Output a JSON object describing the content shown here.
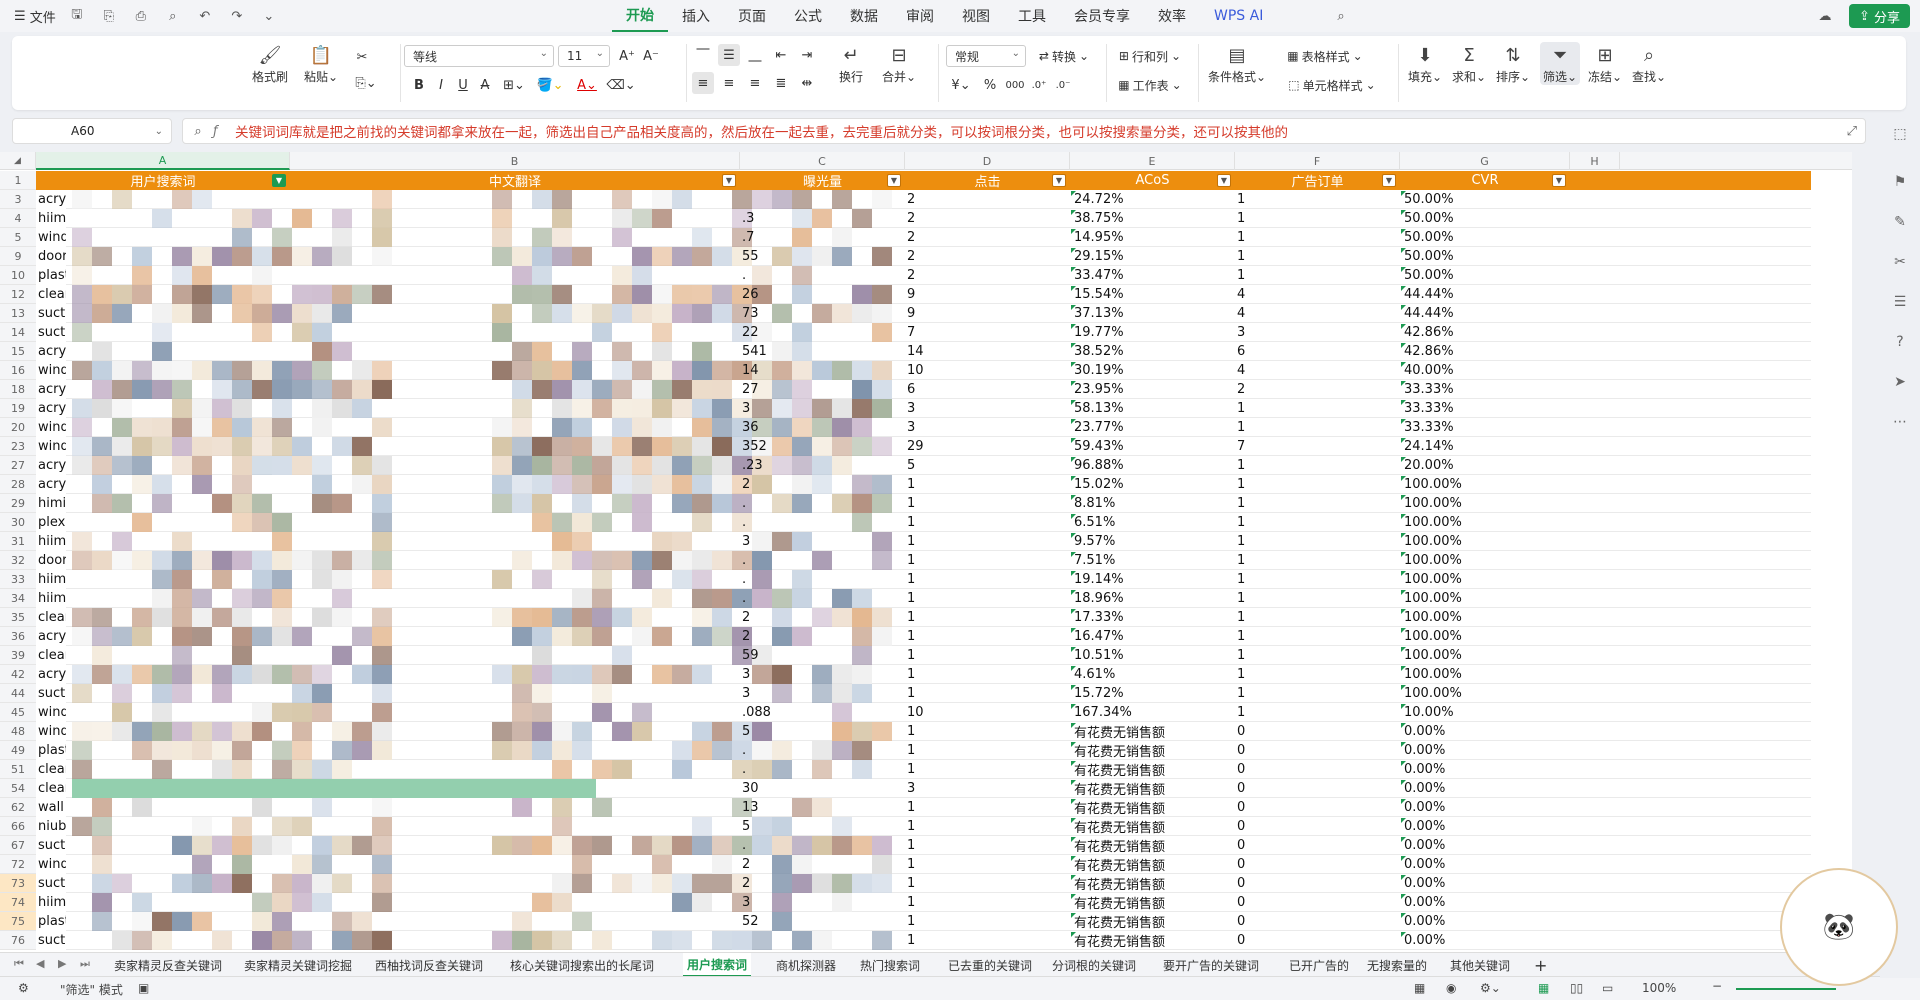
{
  "menubar": {
    "file_label": "文件",
    "tabs": [
      "开始",
      "插入",
      "页面",
      "公式",
      "数据",
      "审阅",
      "视图",
      "工具",
      "会员专享",
      "效率",
      "WPS AI"
    ],
    "share_label": "分享"
  },
  "ribbon": {
    "format_painter": "格式刷",
    "paste": "粘贴",
    "font_name": "等线",
    "font_size": "11",
    "wrap": "换行",
    "merge": "合并",
    "number_format": "常规",
    "convert": "转换",
    "row_col": "行和列",
    "worksheet": "工作表",
    "cond_format": "条件格式",
    "table_style": "表格样式",
    "cell_style": "单元格样式",
    "fill": "填充",
    "sum": "求和",
    "sort": "排序",
    "filter": "筛选",
    "freeze": "冻结",
    "find": "查找",
    "bold": "B",
    "italic": "I",
    "underline": "U",
    "strike": "A",
    "currency": "¥",
    "percent": "%"
  },
  "formula_bar": {
    "name_box": "A60",
    "value": "关键词词库就是把之前找的关键词都拿来放在一起，筛选出自己产品相关度高的，然后放在一起去重，去完重后就分类，可以按词根分类，也可以按搜索量分类，还可以按其他的"
  },
  "columns": [
    "A",
    "B",
    "C",
    "D",
    "E",
    "F",
    "G",
    "H"
  ],
  "header_row": {
    "num": "1",
    "cells": [
      "用户搜索词",
      "中文翻译",
      "曝光量",
      "点击",
      "ACoS",
      "广告订单",
      "CVR"
    ]
  },
  "rows": [
    {
      "n": "3",
      "a": "acryli",
      "c": "",
      "d": "2",
      "e": "24.72%",
      "f": "1",
      "g": "50.00%"
    },
    {
      "n": "4",
      "a": "hiimie",
      "c": ".3",
      "d": "2",
      "e": "38.75%",
      "f": "1",
      "g": "50.00%"
    },
    {
      "n": "5",
      "a": "windo",
      "c": ".7",
      "d": "2",
      "e": "14.95%",
      "f": "1",
      "g": "50.00%"
    },
    {
      "n": "9",
      "a": "door",
      "c": "55",
      "d": "2",
      "e": "29.15%",
      "f": "1",
      "g": "50.00%"
    },
    {
      "n": "10",
      "a": "plasti",
      "c": ".",
      "d": "2",
      "e": "33.47%",
      "f": "1",
      "g": "50.00%"
    },
    {
      "n": "12",
      "a": "clear",
      "c": "26",
      "d": "9",
      "e": "15.54%",
      "f": "4",
      "g": "44.44%"
    },
    {
      "n": "13",
      "a": "suctic",
      "c": "73",
      "d": "9",
      "e": "37.13%",
      "f": "4",
      "g": "44.44%"
    },
    {
      "n": "14",
      "a": "suctic",
      "c": "22",
      "d": "7",
      "e": "19.77%",
      "f": "3",
      "g": "42.86%"
    },
    {
      "n": "15",
      "a": "acryli",
      "c": "541",
      "d": "14",
      "e": "38.52%",
      "f": "6",
      "g": "42.86%"
    },
    {
      "n": "16",
      "a": "windo",
      "c": "14",
      "d": "10",
      "e": "30.19%",
      "f": "4",
      "g": "40.00%"
    },
    {
      "n": "18",
      "a": "acryli",
      "c": "27",
      "d": "6",
      "e": "23.95%",
      "f": "2",
      "g": "33.33%"
    },
    {
      "n": "19",
      "a": "acryli",
      "c": "3",
      "d": "3",
      "e": "58.13%",
      "f": "1",
      "g": "33.33%"
    },
    {
      "n": "20",
      "a": "windo",
      "c": "36",
      "d": "3",
      "e": "23.77%",
      "f": "1",
      "g": "33.33%"
    },
    {
      "n": "23",
      "a": "windo",
      "c": "352",
      "d": "29",
      "e": "59.43%",
      "f": "7",
      "g": "24.14%"
    },
    {
      "n": "27",
      "a": "acryli",
      "c": ".23",
      "d": "5",
      "e": "96.88%",
      "f": "1",
      "g": "20.00%"
    },
    {
      "n": "28",
      "a": "acryli",
      "c": "2",
      "d": "1",
      "e": "15.02%",
      "f": "1",
      "g": "100.00%"
    },
    {
      "n": "29",
      "a": "himie",
      "c": ".",
      "d": "1",
      "e": "8.81%",
      "f": "1",
      "g": "100.00%"
    },
    {
      "n": "30",
      "a": "plexig",
      "c": ".",
      "d": "1",
      "e": "6.51%",
      "f": "1",
      "g": "100.00%"
    },
    {
      "n": "31",
      "a": "hiimie",
      "c": "3",
      "d": "1",
      "e": "9.57%",
      "f": "1",
      "g": "100.00%"
    },
    {
      "n": "32",
      "a": "door",
      "c": ".",
      "d": "1",
      "e": "7.51%",
      "f": "1",
      "g": "100.00%"
    },
    {
      "n": "33",
      "a": "hiimie",
      "c": ".",
      "d": "1",
      "e": "19.14%",
      "f": "1",
      "g": "100.00%"
    },
    {
      "n": "34",
      "a": "hiimie",
      "c": ".",
      "d": "1",
      "e": "18.96%",
      "f": "1",
      "g": "100.00%"
    },
    {
      "n": "35",
      "a": "clear",
      "c": "2",
      "d": "1",
      "e": "17.33%",
      "f": "1",
      "g": "100.00%"
    },
    {
      "n": "36",
      "a": "acryli",
      "c": "2",
      "d": "1",
      "e": "16.47%",
      "f": "1",
      "g": "100.00%"
    },
    {
      "n": "39",
      "a": "clear",
      "c": "59",
      "d": "1",
      "e": "10.51%",
      "f": "1",
      "g": "100.00%"
    },
    {
      "n": "42",
      "a": "acryli",
      "c": "3",
      "d": "1",
      "e": "4.61%",
      "f": "1",
      "g": "100.00%"
    },
    {
      "n": "44",
      "a": "suctic",
      "c": "3",
      "d": "1",
      "e": "15.72%",
      "f": "1",
      "g": "100.00%"
    },
    {
      "n": "45",
      "a": "windo",
      "c": ".088",
      "d": "10",
      "e": "167.34%",
      "f": "1",
      "g": "10.00%"
    },
    {
      "n": "48",
      "a": "windo",
      "c": "5",
      "d": "1",
      "e": "有花费无销售额",
      "f": "0",
      "g": "0.00%"
    },
    {
      "n": "49",
      "a": "plasti",
      "c": ".",
      "d": "1",
      "e": "有花费无销售额",
      "f": "0",
      "g": "0.00%"
    },
    {
      "n": "51",
      "a": "clear",
      "c": ".",
      "d": "1",
      "e": "有花费无销售额",
      "f": "0",
      "g": "0.00%"
    },
    {
      "n": "54",
      "a": "clear",
      "c": "30",
      "d": "3",
      "e": "有花费无销售额",
      "f": "0",
      "g": "0.00%"
    },
    {
      "n": "62",
      "a": "wall s",
      "c": "13",
      "d": "1",
      "e": "有花费无销售额",
      "f": "0",
      "g": "0.00%"
    },
    {
      "n": "66",
      "a": "niube",
      "c": "5",
      "d": "1",
      "e": "有花费无销售额",
      "f": "0",
      "g": "0.00%"
    },
    {
      "n": "67",
      "a": "suctic",
      "c": ".",
      "d": "1",
      "e": "有花费无销售额",
      "f": "0",
      "g": "0.00%"
    },
    {
      "n": "72",
      "a": "windo",
      "c": "2",
      "d": "1",
      "e": "有花费无销售额",
      "f": "0",
      "g": "0.00%"
    },
    {
      "n": "73",
      "a": "suctic",
      "c": "2",
      "d": "1",
      "e": "有花费无销售额",
      "f": "0",
      "g": "0.00%"
    },
    {
      "n": "74",
      "a": "hiimie",
      "c": "3",
      "d": "1",
      "e": "有花费无销售额",
      "f": "0",
      "g": "0.00%"
    },
    {
      "n": "75",
      "a": "plasti",
      "c": "52",
      "d": "1",
      "e": "有花费无销售额",
      "f": "0",
      "g": "0.00%"
    },
    {
      "n": "76",
      "a": "suctic",
      "c": "",
      "d": "1",
      "e": "有花费无销售额",
      "f": "0",
      "g": "0.00%"
    }
  ],
  "sheet_tabs": [
    "卖家精灵反查关键词",
    "卖家精灵关键词挖掘",
    "西柚找词反查关键词",
    "核心关键词搜索出的长尾词",
    "用户搜索词",
    "商机探测器",
    "热门搜索词",
    "已去重的关键词",
    "分词根的关键词",
    "要开广告的关键词",
    "已开广告的",
    "无搜索量的",
    "其他关键词"
  ],
  "active_sheet": "用户搜索词",
  "status": {
    "mode": "\"筛选\" 模式",
    "zoom": "100%"
  },
  "colors": {
    "accent": "#1d9a52",
    "header_orange": "#ed8e0e",
    "formula_red": "#d53b2b"
  }
}
